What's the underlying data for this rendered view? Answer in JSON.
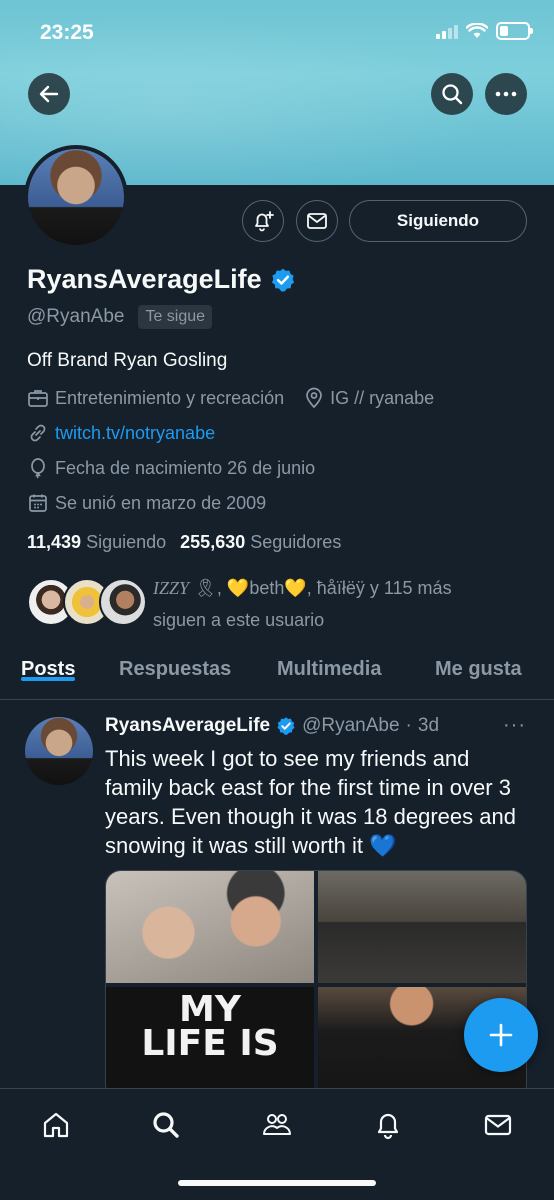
{
  "status_bar": {
    "time": "23:25"
  },
  "profile": {
    "display_name": "RyansAverageLife",
    "handle": "@RyanAbe",
    "follows_you_badge": "Te sigue",
    "bio": "Off Brand Ryan Gosling",
    "category": "Entretenimiento y recreación",
    "location": "IG // ryanabe",
    "website": "twitch.tv/notryanabe",
    "birthday": "Fecha de nacimiento 26 de junio",
    "joined": "Se unió en marzo de 2009",
    "following_count": "11,439",
    "following_label": "Siguiendo",
    "followers_count": "255,630",
    "followers_label": "Seguidores",
    "follow_button": "Siguiendo",
    "followed_by": {
      "name1": "IZZY",
      "name1_emoji": "🎗",
      "name2": "💛beth💛",
      "name3": "ħåïłëÿ",
      "suffix": "y 115 más",
      "line2": "siguen a este usuario"
    }
  },
  "tabs": [
    {
      "label": "Posts",
      "active": true
    },
    {
      "label": "Respuestas",
      "active": false
    },
    {
      "label": "Multimedia",
      "active": false
    },
    {
      "label": "Me gusta",
      "active": false
    }
  ],
  "tweet": {
    "author": "RyansAverageLife",
    "handle": "@RyanAbe",
    "separator": "·",
    "age": "3d",
    "more": "···",
    "text": "This week I got to see my friends and family back east for the first time in over 3 years. Even though it was 18 degrees and snowing it was still worth it 💙",
    "media_3_text": "MY LIFE IS"
  },
  "colors": {
    "background": "#15202b",
    "accent": "#1d9bf0",
    "secondary_text": "#8b98a5",
    "border": "#38444d"
  },
  "icons": {
    "back": "arrow-left-icon",
    "search": "search-icon",
    "more": "more-icon",
    "notify": "bell-plus-icon",
    "message": "envelope-icon",
    "verified": "verified-badge-icon",
    "compose": "plus-icon",
    "nav": [
      "home-icon",
      "search-icon",
      "communities-icon",
      "bell-icon",
      "envelope-icon"
    ]
  }
}
